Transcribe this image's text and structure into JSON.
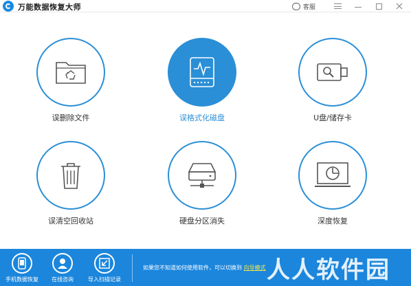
{
  "window": {
    "title": "万能数据恢复大师",
    "service_label": "客服"
  },
  "tiles": [
    {
      "label": "误删除文件",
      "icon": "folder-recycle-icon",
      "active": false
    },
    {
      "label": "误格式化磁盘",
      "icon": "disk-pulse-icon",
      "active": true
    },
    {
      "label": "U盘/储存卡",
      "icon": "usb-drive-icon",
      "active": false
    },
    {
      "label": "误清空回收站",
      "icon": "trash-bin-icon",
      "active": false
    },
    {
      "label": "硬盘分区消失",
      "icon": "hard-drive-icon",
      "active": false
    },
    {
      "label": "深度恢复",
      "icon": "monitor-scan-icon",
      "active": false
    }
  ],
  "bottom": {
    "items": [
      {
        "label": "手机数据恢复",
        "icon": "phone-icon"
      },
      {
        "label": "在线咨询",
        "icon": "person-icon"
      },
      {
        "label": "导入扫描记录",
        "icon": "import-icon"
      }
    ],
    "hint_text": "如果您不知道如何使用软件，可以切换到",
    "hint_link": "向导模式"
  },
  "watermark": "人人软件园",
  "colors": {
    "accent": "#2a8fd6",
    "bottom_bar": "#1b86dc",
    "link": "#f5e94a"
  }
}
